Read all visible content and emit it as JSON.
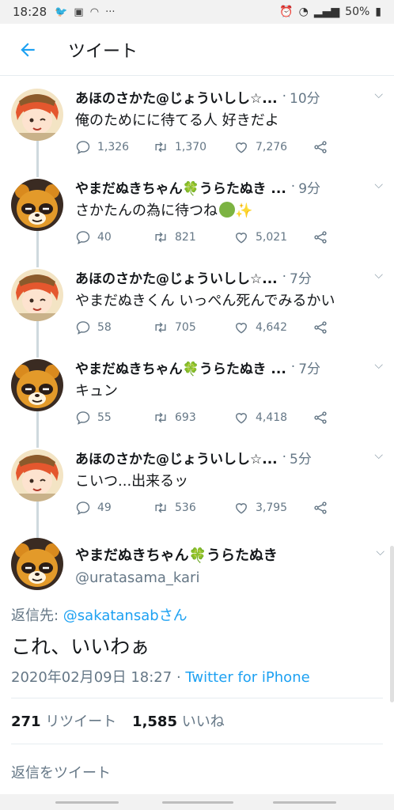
{
  "statusbar": {
    "time": "18:28",
    "icons": [
      "twitter-icon",
      "app-icon",
      "headset-icon"
    ],
    "more": "···",
    "battery": "50%"
  },
  "header": {
    "title": "ツイート"
  },
  "tweets": [
    {
      "name": "あほのさかた@じょういしし☆...",
      "time": "10分",
      "text": "俺のためにに待てる人 好きだよ",
      "replies": "1,326",
      "retweets": "1,370",
      "likes": "7,276",
      "avatar": "sakata"
    },
    {
      "name": "やまだぬきちゃん🍀うらたぬき ...",
      "time": "9分",
      "text": "さかたんの為に待つね",
      "replies": "40",
      "retweets": "821",
      "likes": "5,021",
      "avatar": "tanuki"
    },
    {
      "name": "あほのさかた@じょういしし☆...",
      "time": "7分",
      "text": "やまだぬきくん いっぺん死んでみるかい",
      "replies": "58",
      "retweets": "705",
      "likes": "4,642",
      "avatar": "sakata"
    },
    {
      "name": "やまだぬきちゃん🍀うらたぬき ...",
      "time": "7分",
      "text": "キュン",
      "replies": "55",
      "retweets": "693",
      "likes": "4,418",
      "avatar": "tanuki"
    },
    {
      "name": "あほのさかた@じょういしし☆...",
      "time": "5分",
      "text": "こいつ...出来るッ",
      "replies": "49",
      "retweets": "536",
      "likes": "3,795",
      "avatar": "sakata"
    }
  ],
  "main": {
    "name": "やまだぬきちゃん🍀うらたぬき",
    "handle": "@uratasama_kari",
    "reply_prefix": "返信先: ",
    "reply_link": "@sakatansab",
    "reply_suffix": "さん",
    "text": "これ、いいわぁ",
    "datetime": "2020年02月09日 18:27",
    "meta_sep": " · ",
    "source": "Twitter for iPhone",
    "retweet_count": "271",
    "retweet_label": "リツイート",
    "like_count": "1,585",
    "like_label": "いいね",
    "reply_placeholder": "返信をツイート"
  },
  "colors": {
    "accent": "#1da1f2",
    "secondary_text": "#657786",
    "thread_line": "#cfd9de"
  }
}
